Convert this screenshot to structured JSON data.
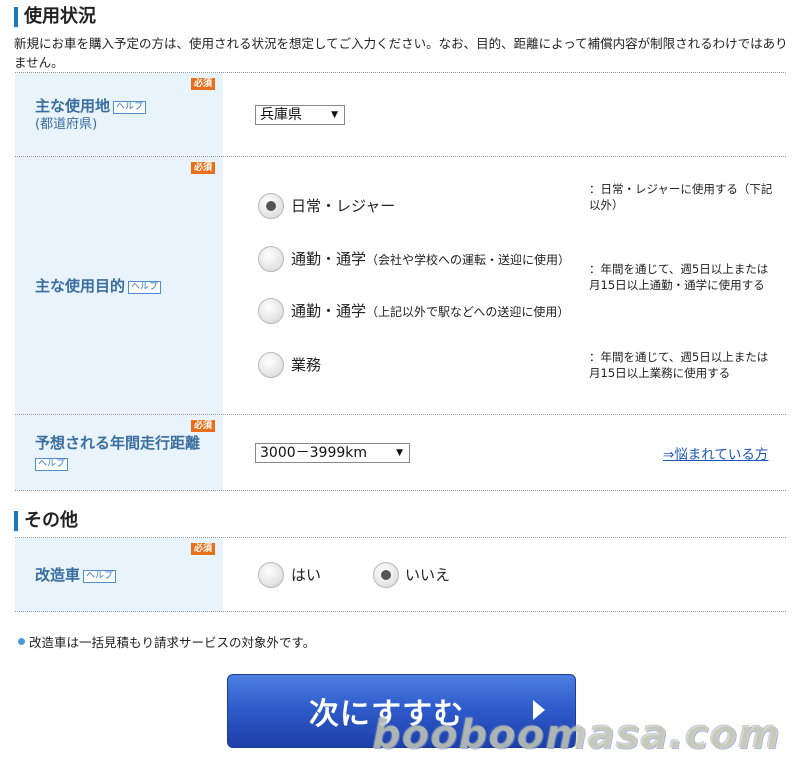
{
  "usage": {
    "heading": "使用状況",
    "intro": "新規にお車を購入予定の方は、使用される状況を想定してご入力ください。なお、目的、距離によって補償内容が制限されるわけではありません。",
    "required_label": "必須",
    "help_label": "ヘルプ",
    "location": {
      "label": "主な使用地",
      "sublabel": "(都道府県)",
      "selected": "兵庫県"
    },
    "purpose": {
      "label": "主な使用目的",
      "options": [
        {
          "label": "日常・レジャー",
          "paren": "",
          "checked": true
        },
        {
          "label": "通勤・通学",
          "paren": "（会社や学校への運転・送迎に使用）",
          "checked": false
        },
        {
          "label": "通勤・通学",
          "paren": "（上記以外で駅などへの送迎に使用）",
          "checked": false
        },
        {
          "label": "業務",
          "paren": "",
          "checked": false
        }
      ],
      "notes": [
        "：日常・レジャーに使用する（下記以外）",
        "：年間を通じて、週5日以上または月15日以上通勤・通学に使用する",
        "：年間を通じて、週5日以上または月15日以上業務に使用する"
      ]
    },
    "distance": {
      "label": "予想される年間走行距離",
      "selected": "3000－3999km",
      "link": "⇒悩まれている方"
    }
  },
  "other": {
    "heading": "その他",
    "modified": {
      "label": "改造車",
      "options": [
        {
          "label": "はい",
          "checked": false
        },
        {
          "label": "いいえ",
          "checked": true
        }
      ]
    },
    "note": "改造車は一括見積もり請求サービスの対象外です。"
  },
  "next_button": "次にすすむ",
  "watermark": "booboomasa.com"
}
